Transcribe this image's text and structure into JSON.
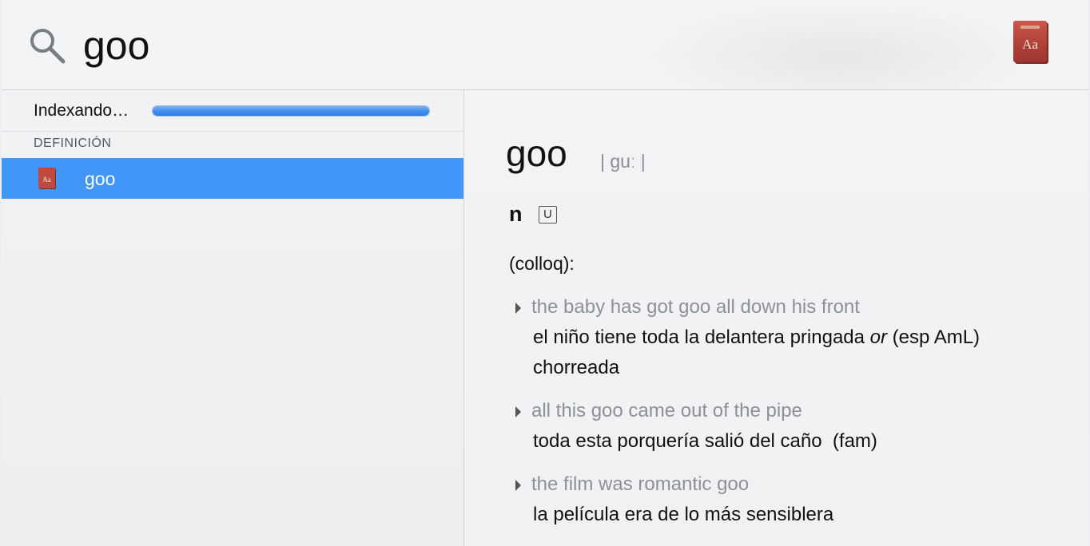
{
  "search": {
    "query": "goo"
  },
  "sidebar": {
    "indexing_label": "Indexando…",
    "indexing_progress": 1.0,
    "section_header": "DEFINICIÓN",
    "results": [
      {
        "label": "goo",
        "icon": "dictionary-icon",
        "selected": true
      }
    ]
  },
  "definition": {
    "headword": "goo",
    "pronunciation": "| guː |",
    "part_of_speech": "n",
    "grammar_label": "U",
    "register": "(colloq):",
    "examples": [
      {
        "english": "the baby has got goo all down his front",
        "spanish_before": "el niño tiene toda la delantera pringada ",
        "spanish_or": "or",
        "spanish_after": " (esp AmL) chorreada"
      },
      {
        "english": "all this goo came out of the pipe",
        "spanish": "toda esta porquería salió del caño  (fam)"
      },
      {
        "english": "the film was romantic goo",
        "spanish": "la película era de lo más sensiblera"
      }
    ]
  },
  "colors": {
    "selection": "#4196f7",
    "progress": "#3f8cec",
    "dictionary_red": "#b8423a"
  }
}
